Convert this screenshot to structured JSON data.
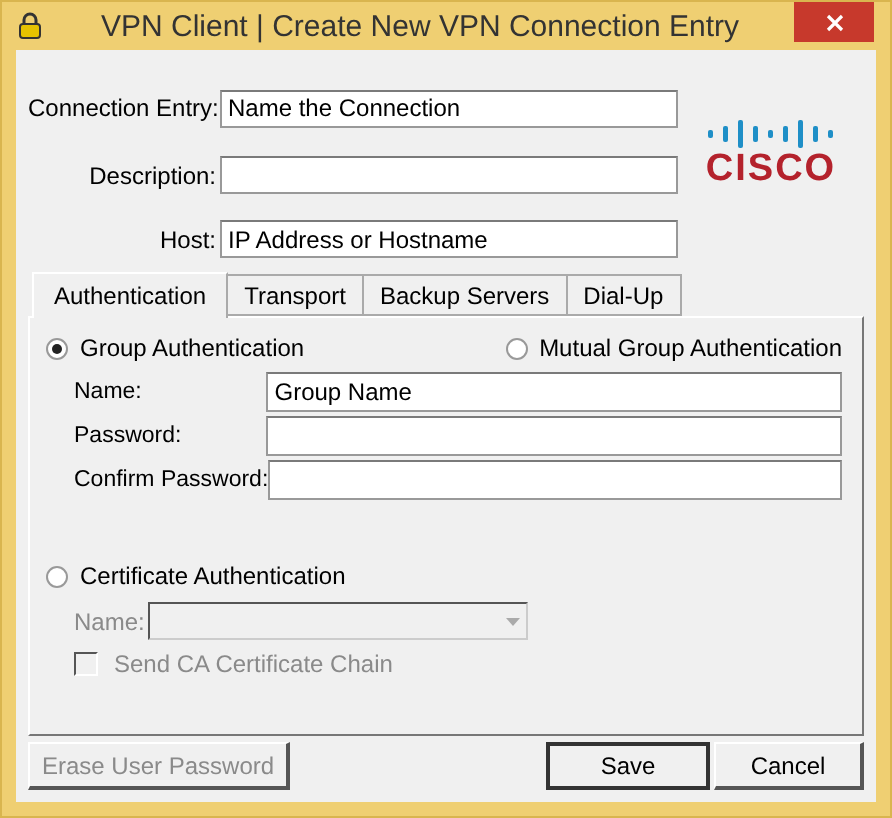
{
  "window": {
    "title": "VPN Client  |  Create New VPN Connection Entry"
  },
  "fields": [
    {
      "label": "Connection Entry:",
      "value": "Name the Connection"
    },
    {
      "label": "Description:"
    },
    {
      "label": "Host:",
      "value": "IP Address or Hostname"
    }
  ],
  "logo": {
    "text": "CISCO"
  },
  "tabs": [
    {
      "label": "Authentication",
      "selected": true
    },
    {
      "label": "Transport",
      "selected": false
    },
    {
      "label": "Backup Servers",
      "selected": false
    },
    {
      "label": "Dial-Up",
      "selected": false
    }
  ],
  "group_auth": {
    "label": "Group Authentication",
    "selected": true
  },
  "mutual_auth": {
    "label": "Mutual Group Authentication",
    "selected": false
  },
  "group_fields": [
    {
      "label": "Name:",
      "value": "Group Name"
    },
    {
      "label": "Password:"
    },
    {
      "label": "Confirm Password:"
    }
  ],
  "cert_auth": {
    "label": "Certificate Authentication",
    "selected": false
  },
  "cert_name": {
    "label": "Name:",
    "disabled": true
  },
  "send_chain": {
    "label": "Send CA Certificate Chain",
    "checked": false,
    "disabled": true
  },
  "buttons": [
    {
      "label": "Erase User Password",
      "disabled": true,
      "default": false
    },
    {
      "label": "Save",
      "disabled": false,
      "default": true
    },
    {
      "label": "Cancel",
      "disabled": false,
      "default": false
    }
  ]
}
